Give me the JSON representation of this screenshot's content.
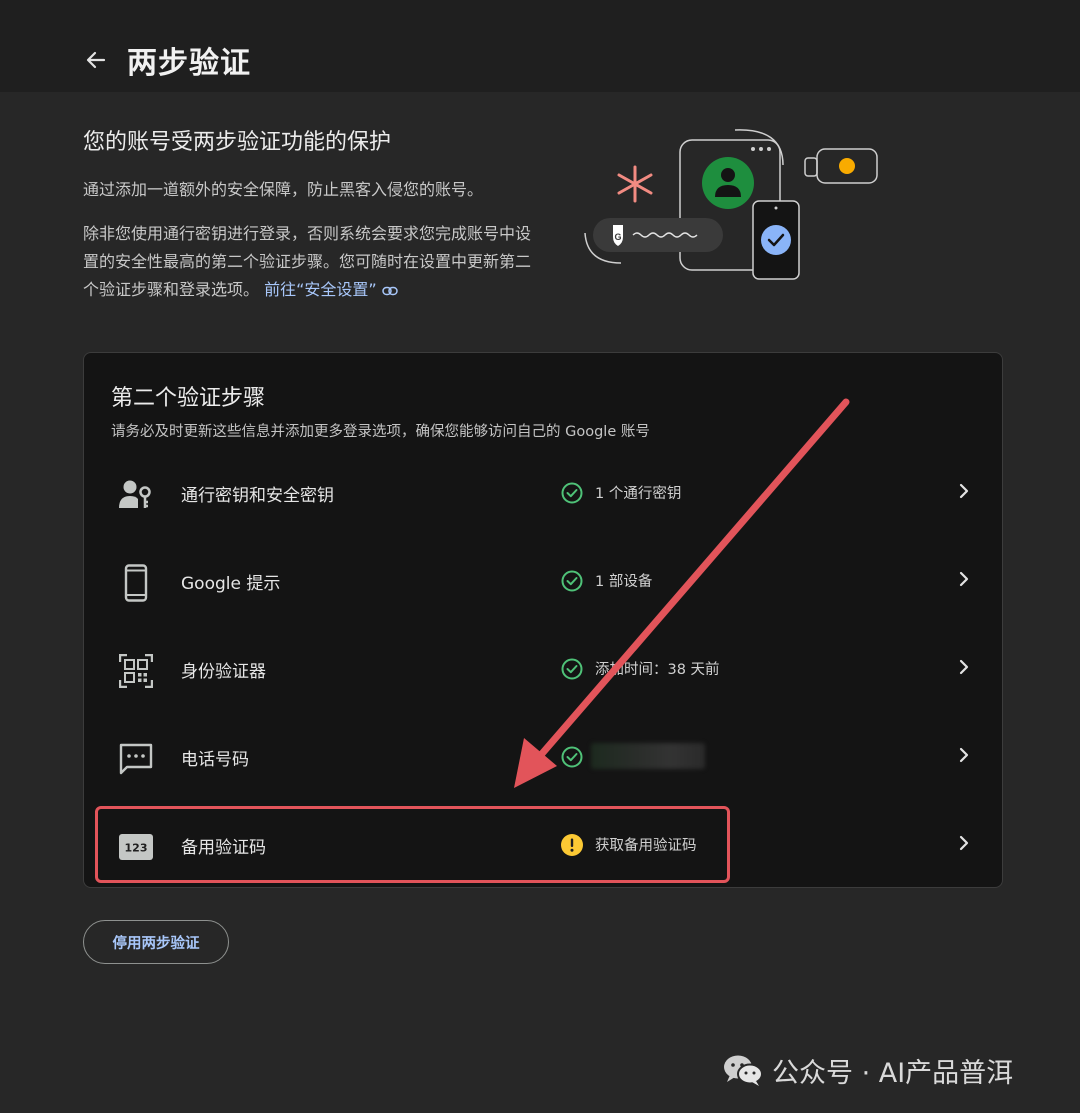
{
  "header": {
    "title": "两步验证"
  },
  "intro": {
    "heading": "您的账号受两步验证功能的保护",
    "paragraph1": "通过添加一道额外的安全保障，防止黑客入侵您的账号。",
    "paragraph2": "除非您使用通行密钥进行登录，否则系统会要求您完成账号中设置的安全性最高的第二个验证步骤。您可随时在设置中更新第二个验证步骤和登录选项。",
    "link_text": "前往“安全设置”"
  },
  "illustration": {
    "google_badge_letter": "G"
  },
  "second_step": {
    "title": "第二个验证步骤",
    "subtitle": "请务必及时更新这些信息并添加更多登录选项，确保您能够访问自己的 Google 账号",
    "items": [
      {
        "label": "通行密钥和安全密钥",
        "status": "1 个通行密钥",
        "status_type": "ok",
        "icon": "passkey-icon"
      },
      {
        "label": "Google 提示",
        "status": "1 部设备",
        "status_type": "ok",
        "icon": "phone-icon"
      },
      {
        "label": "身份验证器",
        "status": "添加时间：38 天前",
        "status_type": "ok",
        "icon": "qr-code-icon"
      },
      {
        "label": "电话号码",
        "status": "",
        "status_type": "ok",
        "icon": "message-icon"
      },
      {
        "label": "备用验证码",
        "status": "获取备用验证码",
        "status_type": "warning",
        "icon": "backup-code-icon",
        "icon_text": "123"
      }
    ]
  },
  "actions": {
    "disable_label": "停用两步验证"
  },
  "watermark": {
    "text": "公众号 · AI产品普洱"
  },
  "colors": {
    "background": "#272727",
    "card": "#141414",
    "ok_green": "#4fc278",
    "warning_yellow": "#fcc934",
    "link_blue": "#a8c7fa",
    "annotation_red": "#e2545a"
  }
}
